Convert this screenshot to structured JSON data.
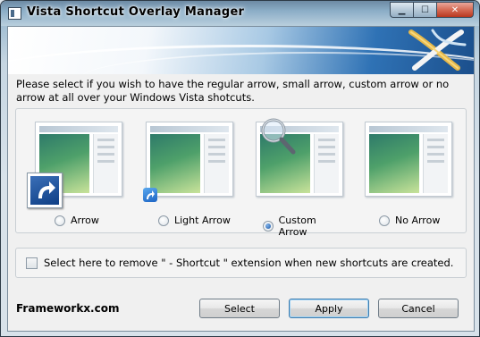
{
  "window": {
    "title": "Vista Shortcut Overlay Manager",
    "controls": {
      "minimize": "▁",
      "maximize": "☐",
      "close": "✕"
    }
  },
  "intro_text": "Please select if you wish to have the regular arrow, small arrow, custom arrow or no arrow at all over your Windows Vista shotcuts.",
  "options": [
    {
      "label": "Arrow",
      "selected": false,
      "overlay": "large-arrow-icon"
    },
    {
      "label": "Light Arrow",
      "selected": false,
      "overlay": "small-arrow-icon"
    },
    {
      "label": "Custom Arrow",
      "selected": true,
      "overlay": "magnifier-icon"
    },
    {
      "label": "No Arrow",
      "selected": false,
      "overlay": "none"
    }
  ],
  "checkbox": {
    "label": "Select here to remove \" - Shortcut \" extension when new shortcuts are created.",
    "checked": false
  },
  "footer": {
    "site": "Frameworkx.com",
    "buttons": {
      "select": "Select",
      "apply": "Apply",
      "cancel": "Cancel"
    }
  },
  "colors": {
    "accent": "#1e5aa8",
    "banner_blue": "#1b4f8c",
    "dialog_bg": "#f0f0f0"
  }
}
